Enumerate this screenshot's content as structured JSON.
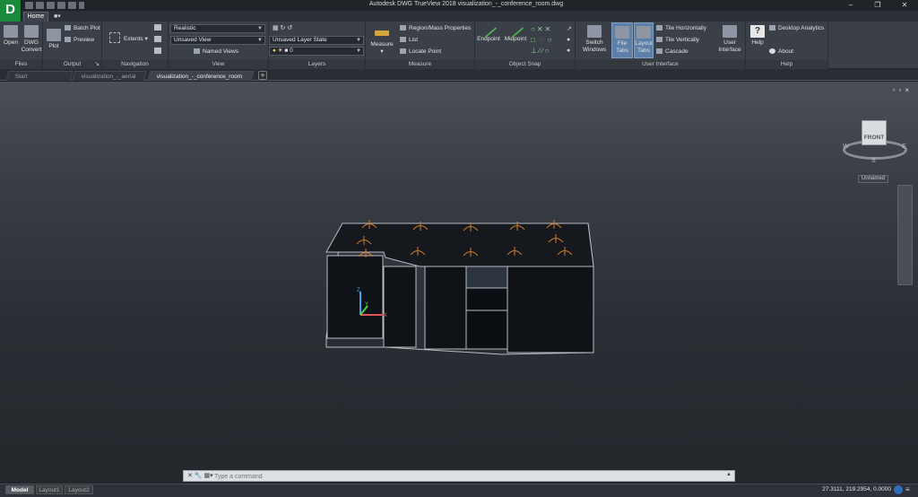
{
  "app": {
    "logo": "D",
    "window_title": "Autodesk DWG TrueView 2018   visualization_-_conference_room.dwg",
    "ribbon_tabs": [
      "Home"
    ]
  },
  "panels": {
    "files": {
      "title": "Files",
      "open": "Open",
      "dwg_convert": "DWG Convert"
    },
    "output": {
      "title": "Output",
      "plot": "Plot",
      "batch_plot": "Batch Plot",
      "preview": "Preview"
    },
    "navigation": {
      "title": "Navigation",
      "extents": "Extents"
    },
    "view": {
      "title": "View",
      "visual_style": "Realistic",
      "saved_view": "Unsaved View",
      "named_views": "Named Views"
    },
    "layers": {
      "title": "Layers",
      "layer_state": "Unsaved Layer State",
      "layer_current": "0"
    },
    "measure": {
      "title": "Measure",
      "measure": "Measure",
      "region_mass": "Region/Mass Properties",
      "list": "List",
      "locate_point": "Locate Point"
    },
    "object_snap": {
      "title": "Object Snap",
      "endpoint": "Endpoint",
      "midpoint": "Midpoint"
    },
    "user_interface": {
      "title": "User Interface",
      "switch_windows": "Switch Windows",
      "file_tabs": "File Tabs",
      "layout_tabs": "Layout Tabs",
      "tile_horizontally": "Tile Horizontally",
      "tile_vertically": "Tile Vertically",
      "cascade": "Cascade",
      "user_interface": "User Interface"
    },
    "help": {
      "title": "Help",
      "help": "Help",
      "desktop_analytics": "Desktop Analytics",
      "about": "About"
    }
  },
  "doc_tabs": [
    "Start",
    "visualization_-_aerial",
    "visualization_-_conference_room"
  ],
  "viewcube": {
    "face": "FRONT",
    "north": "N",
    "south": "S",
    "east": "E",
    "west": "W",
    "ucs_name": "Unnamed"
  },
  "command_line": {
    "placeholder": "Type a command"
  },
  "layout_tabs": [
    "Model",
    "Layout1",
    "Layout2"
  ],
  "status": {
    "coords": "27.3111, 219.2954, 0.0000"
  },
  "colors": {
    "accent_toggle": "#5d7fa8",
    "logo_green": "#1a8a3c",
    "light_orange": "#d07a2a"
  }
}
